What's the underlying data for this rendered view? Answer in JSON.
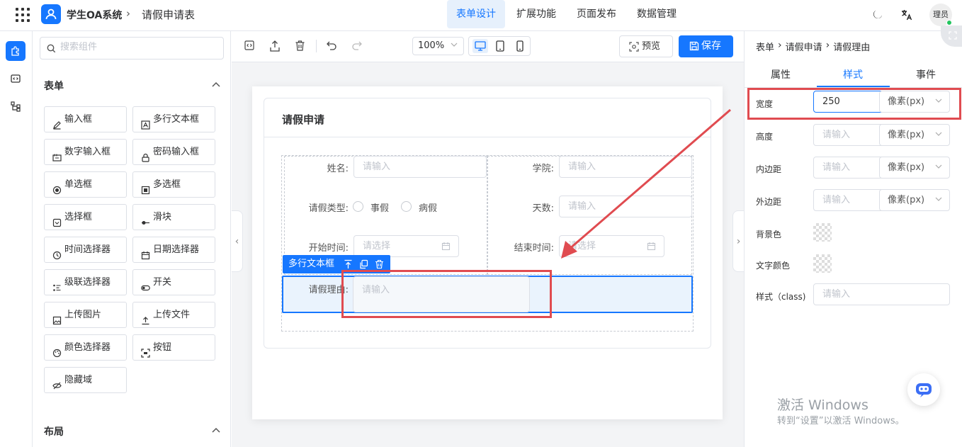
{
  "header": {
    "app_title": "学生OA系统",
    "page_title": "请假申请表",
    "nav": [
      "表单设计",
      "扩展功能",
      "页面发布",
      "数据管理"
    ],
    "active_nav": "表单设计",
    "user_name": "理员"
  },
  "left_panel": {
    "search_placeholder": "搜索组件",
    "form_group_title": "表单",
    "layout_group_title": "布局",
    "components": [
      {
        "label": "输入框",
        "icon": "edit-icon"
      },
      {
        "label": "多行文本框",
        "icon": "textarea-icon"
      },
      {
        "label": "数字输入框",
        "icon": "number-icon"
      },
      {
        "label": "密码输入框",
        "icon": "lock-icon"
      },
      {
        "label": "单选框",
        "icon": "radio-icon"
      },
      {
        "label": "多选框",
        "icon": "checkbox-icon"
      },
      {
        "label": "选择框",
        "icon": "select-icon"
      },
      {
        "label": "滑块",
        "icon": "slider-icon"
      },
      {
        "label": "时间选择器",
        "icon": "clock-icon"
      },
      {
        "label": "日期选择器",
        "icon": "calendar-icon"
      },
      {
        "label": "级联选择器",
        "icon": "cascader-icon"
      },
      {
        "label": "开关",
        "icon": "switch-icon"
      },
      {
        "label": "上传图片",
        "icon": "image-icon"
      },
      {
        "label": "上传文件",
        "icon": "upload-icon"
      },
      {
        "label": "颜色选择器",
        "icon": "palette-icon"
      },
      {
        "label": "按钮",
        "icon": "button-icon"
      },
      {
        "label": "隐藏域",
        "icon": "eye-off-icon"
      }
    ]
  },
  "toolbar": {
    "zoom": "100%",
    "preview_label": "预览",
    "save_label": "保存"
  },
  "form": {
    "title": "请假申请",
    "fields": {
      "name_label": "姓名:",
      "name_placeholder": "请输入",
      "college_label": "学院:",
      "college_placeholder": "请输入",
      "leave_type_label": "请假类型:",
      "leave_options": [
        "事假",
        "病假"
      ],
      "days_label": "天数:",
      "days_placeholder": "请输入",
      "start_label": "开始时间:",
      "start_placeholder": "请选择",
      "end_label": "结束时间:",
      "end_placeholder": "请选择",
      "reason_label": "请假理由:",
      "reason_placeholder": "请输入"
    },
    "selected_tag": "多行文本框"
  },
  "right_panel": {
    "breadcrumb": [
      "表单",
      "请假申请",
      "请假理由"
    ],
    "tabs": [
      "属性",
      "样式",
      "事件"
    ],
    "active_tab": "样式",
    "width_label": "宽度",
    "width_value": "250",
    "height_label": "高度",
    "padding_label": "内边距",
    "margin_label": "外边距",
    "bg_label": "背景色",
    "text_color_label": "文字颜色",
    "class_label": "样式（class)",
    "unit": "像素(px)",
    "placeholder": "请输入"
  },
  "watermark": {
    "line1": "激活 Windows",
    "line2": "转到“设置”以激活 Windows。"
  },
  "colors": {
    "primary": "#1677ff",
    "annotation_red": "#e04b50"
  }
}
